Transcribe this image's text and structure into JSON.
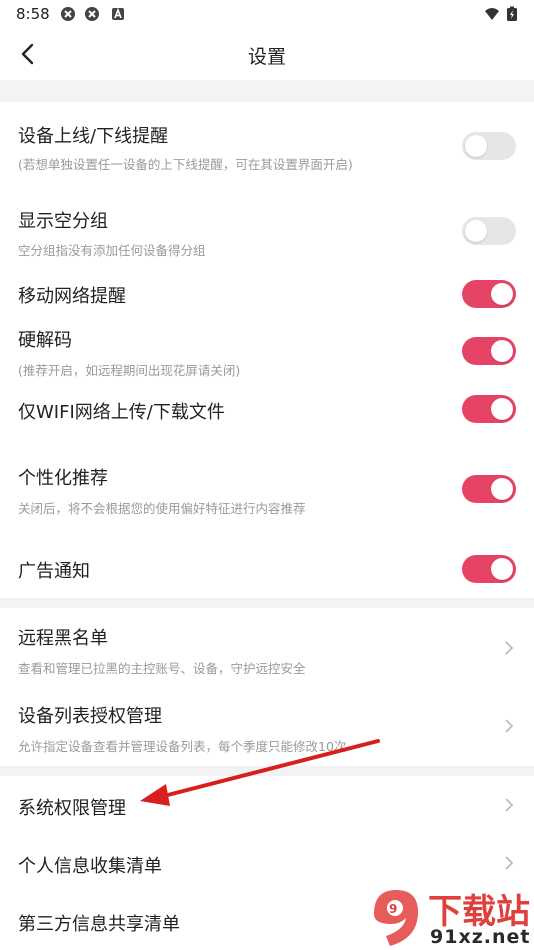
{
  "status_bar": {
    "time": "8:58"
  },
  "header": {
    "title": "设置"
  },
  "settings": [
    {
      "label": "设备上线/下线提醒",
      "sub": "(若想单独设置任一设备的上下线提醒，可在其设置界面开启)",
      "toggle": "off"
    },
    {
      "label": "显示空分组",
      "sub": "空分组指没有添加任何设备得分组",
      "toggle": "off"
    },
    {
      "label": "移动网络提醒",
      "sub": "",
      "toggle": "on"
    },
    {
      "label": "硬解码",
      "sub": "(推荐开启，如远程期间出现花屏请关闭)",
      "toggle": "on"
    },
    {
      "label": "仅WIFI网络上传/下载文件",
      "sub": "",
      "toggle": "on"
    },
    {
      "label": "个性化推荐",
      "sub": "关闭后，将不会根据您的使用偏好特征进行内容推荐",
      "toggle": "on"
    },
    {
      "label": "广告通知",
      "sub": "",
      "toggle": "on"
    }
  ],
  "security": [
    {
      "label": "远程黑名单",
      "sub": "查看和管理已拉黑的主控账号、设备，守护远控安全"
    },
    {
      "label": "设备列表授权管理",
      "sub": "允许指定设备查看并管理设备列表，每个季度只能修改10次"
    }
  ],
  "privacy": [
    {
      "label": "系统权限管理"
    },
    {
      "label": "个人信息收集清单"
    },
    {
      "label": "第三方信息共享清单"
    }
  ],
  "watermark": {
    "main": "下载站",
    "domain": "91xz.net",
    "logo": "9"
  },
  "colors": {
    "accent": "#e64466",
    "toggle_off": "#e6e6e6",
    "divider": "#f3f3f5",
    "annotation": "#d81f1f"
  }
}
